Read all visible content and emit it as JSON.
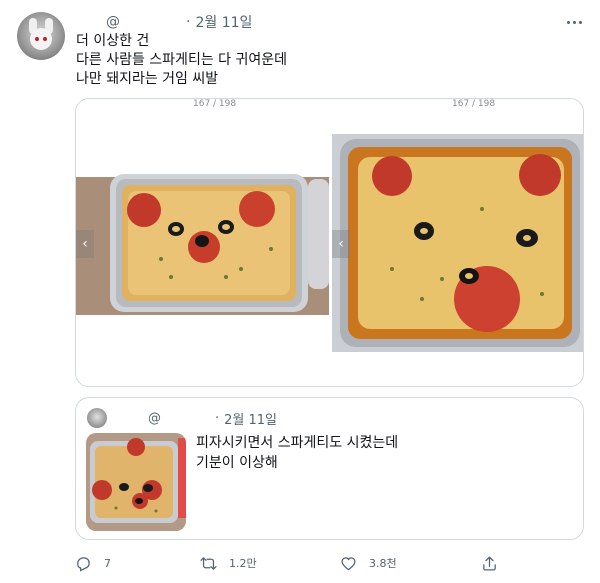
{
  "tweet": {
    "handle": "@",
    "separator": "·",
    "date": "2월 11일",
    "lines": [
      "더 이상한 건",
      "다른 사람들 스파게티는 다 귀여운데",
      "나만 돼지라는 거임 씨발"
    ]
  },
  "media": {
    "left_counter": "167 / 198",
    "right_counter": "167 / 198"
  },
  "quote": {
    "handle": "@",
    "separator": "·",
    "date": "2월 11일",
    "lines": [
      "피자시키면서 스파게티도 시켰는데",
      "기분이 이상해"
    ]
  },
  "actions": {
    "reply_count": "7",
    "retweet_count": "1.2만",
    "like_count": "3.8천"
  },
  "icons": {
    "more": "more-icon",
    "reply": "reply-icon",
    "retweet": "retweet-icon",
    "like": "like-icon",
    "share": "share-icon"
  },
  "colors": {
    "text_primary": "#0f1419",
    "text_secondary": "#536471",
    "border": "#cfd9de"
  }
}
